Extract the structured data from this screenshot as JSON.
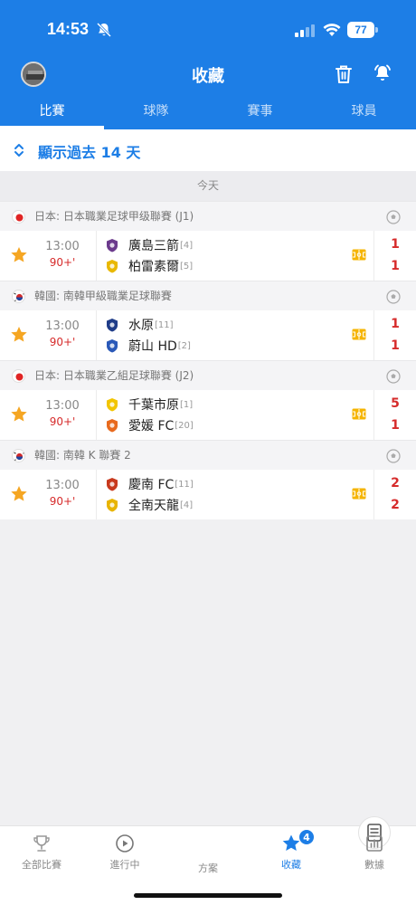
{
  "status_bar": {
    "time": "14:53",
    "battery": "77"
  },
  "header": {
    "title": "收藏"
  },
  "tabs": [
    {
      "label": "比賽",
      "active": true
    },
    {
      "label": "球隊",
      "active": false
    },
    {
      "label": "賽事",
      "active": false
    },
    {
      "label": "球員",
      "active": false
    }
  ],
  "range_filter": {
    "label": "顯示過去 14 天"
  },
  "day_header": "今天",
  "leagues": [
    {
      "flag": "japan",
      "name": "日本: 日本職業足球甲级聯賽 (J1)",
      "match": {
        "time": "13:00",
        "minute": "90+'",
        "home": {
          "name": "廣島三箭",
          "rank": "[4]",
          "score": "1",
          "logo_color": "#6b3a8c"
        },
        "away": {
          "name": "柏雷素爾",
          "rank": "[5]",
          "score": "1",
          "logo_color": "#e9b800"
        }
      }
    },
    {
      "flag": "korea",
      "name": "韓國: 南韓甲級職業足球聯賽",
      "match": {
        "time": "13:00",
        "minute": "90+'",
        "home": {
          "name": "水原",
          "rank": "[11]",
          "score": "1",
          "logo_color": "#1f3c88"
        },
        "away": {
          "name": "蔚山 HD",
          "rank": "[2]",
          "score": "1",
          "logo_color": "#2a59b8"
        }
      }
    },
    {
      "flag": "japan",
      "name": "日本: 日本職業乙組足球聯賽 (J2)",
      "match": {
        "time": "13:00",
        "minute": "90+'",
        "home": {
          "name": "千葉市原",
          "rank": "[1]",
          "score": "5",
          "logo_color": "#f2c500"
        },
        "away": {
          "name": "愛媛 FC",
          "rank": "[20]",
          "score": "1",
          "logo_color": "#e86a1e"
        }
      }
    },
    {
      "flag": "korea",
      "name": "韓國: 南韓 K 聯賽 2",
      "match": {
        "time": "13:00",
        "minute": "90+'",
        "home": {
          "name": "慶南 FC",
          "rank": "[11]",
          "score": "2",
          "logo_color": "#c8391d"
        },
        "away": {
          "name": "全南天龍",
          "rank": "[4]",
          "score": "2",
          "logo_color": "#e8b400"
        }
      }
    }
  ],
  "bottom_nav": [
    {
      "label": "全部比賽",
      "icon": "trophy-icon"
    },
    {
      "label": "進行中",
      "icon": "play-icon"
    },
    {
      "label": "方案",
      "icon": "plan-icon"
    },
    {
      "label": "收藏",
      "icon": "star-icon",
      "badge": "4",
      "active": true
    },
    {
      "label": "數據",
      "icon": "stats-icon"
    }
  ],
  "colors": {
    "primary": "#1d7ee6",
    "live_red": "#d62b2b",
    "star": "#f5a623"
  }
}
